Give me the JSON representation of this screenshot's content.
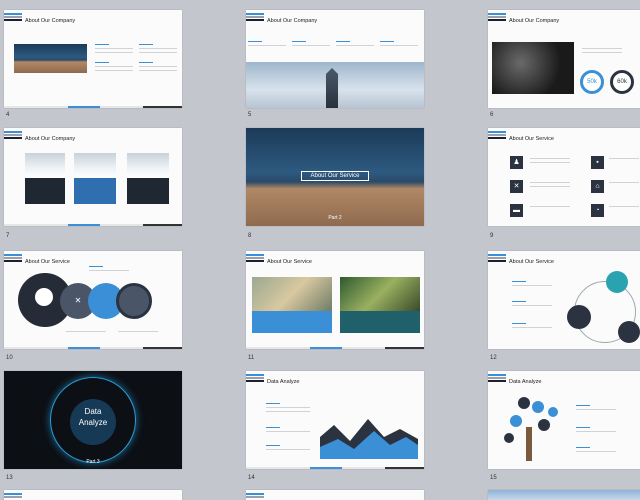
{
  "slides": [
    {
      "num": "4",
      "title": "About Our Company"
    },
    {
      "num": "5",
      "title": "About Our Company"
    },
    {
      "num": "6",
      "title": "About Our Company",
      "badges": [
        "50k",
        "60k"
      ]
    },
    {
      "num": "7",
      "title": "About Our Company"
    },
    {
      "num": "8",
      "title": "About Our Service",
      "sub": "Part 2"
    },
    {
      "num": "9",
      "title": "About Our Service"
    },
    {
      "num": "10",
      "title": "About Our Service"
    },
    {
      "num": "11",
      "title": "About Our Service"
    },
    {
      "num": "12",
      "title": "About Our Service"
    },
    {
      "num": "13",
      "title_line1": "Data",
      "title_line2": "Analyze",
      "sub": "Part 3"
    },
    {
      "num": "14",
      "title": "Data Analyze"
    },
    {
      "num": "15",
      "title": "Data Analyze"
    }
  ],
  "colors": {
    "accent": "#3a8fd6",
    "dark": "#2b3340",
    "background": "#c3c6cd"
  },
  "icons": [
    "person-icon",
    "tools-icon",
    "truck-icon",
    "clock-icon",
    "group-icon",
    "briefcase-icon",
    "chart-icon"
  ]
}
